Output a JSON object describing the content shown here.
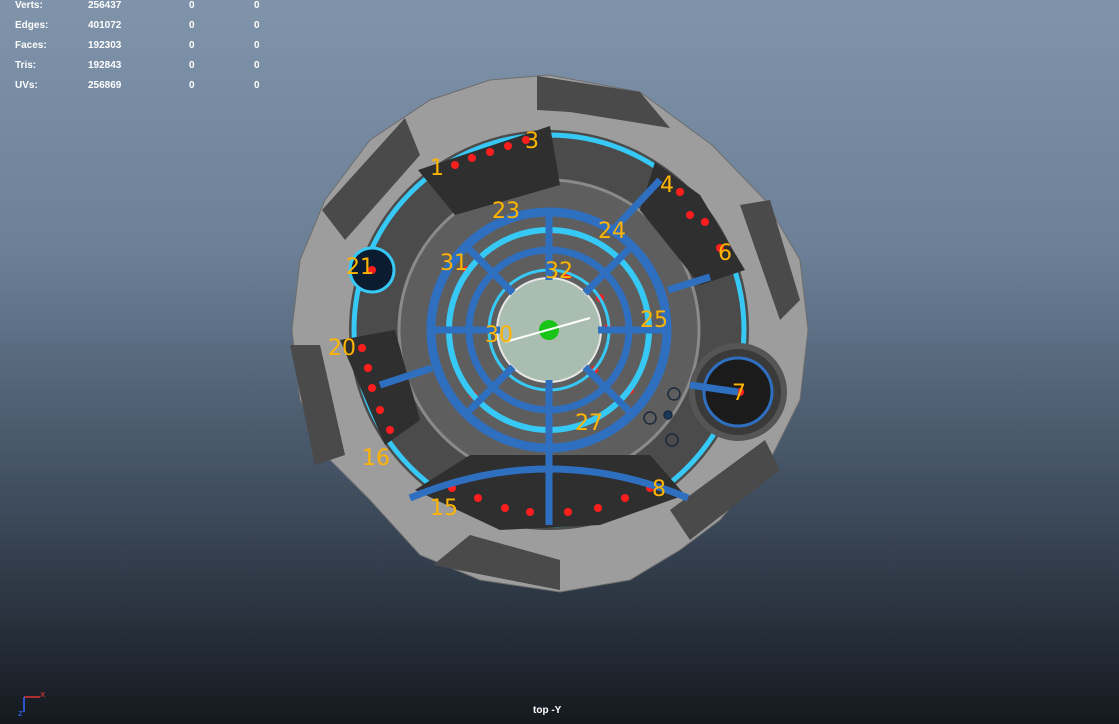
{
  "hud": {
    "rows": [
      {
        "label": "Verts:",
        "v1": "256437",
        "v2": "0",
        "v3": "0"
      },
      {
        "label": "Edges:",
        "v1": "401072",
        "v2": "0",
        "v3": "0"
      },
      {
        "label": "Faces:",
        "v1": "192303",
        "v2": "0",
        "v3": "0"
      },
      {
        "label": "Tris:",
        "v1": "192843",
        "v2": "0",
        "v3": "0"
      },
      {
        "label": "UVs:",
        "v1": "256869",
        "v2": "0",
        "v3": "0"
      }
    ]
  },
  "camera_label": "top -Y",
  "axis": {
    "x_label": "x",
    "z_label": "z"
  },
  "annotations": [
    "1",
    "3",
    "4",
    "6",
    "7",
    "8",
    "15",
    "16",
    "20",
    "21",
    "23",
    "24",
    "25",
    "27",
    "30",
    "31",
    "32"
  ],
  "colors": {
    "outer_ring": "#9d9d9d",
    "cyan_ring": "#36c9f5",
    "blue_struct": "#2f6fc0",
    "dark_module": "#3a3a3a",
    "red_light": "#ff1e1e",
    "annotation": "#ffb400",
    "center_green": "#19c419"
  }
}
